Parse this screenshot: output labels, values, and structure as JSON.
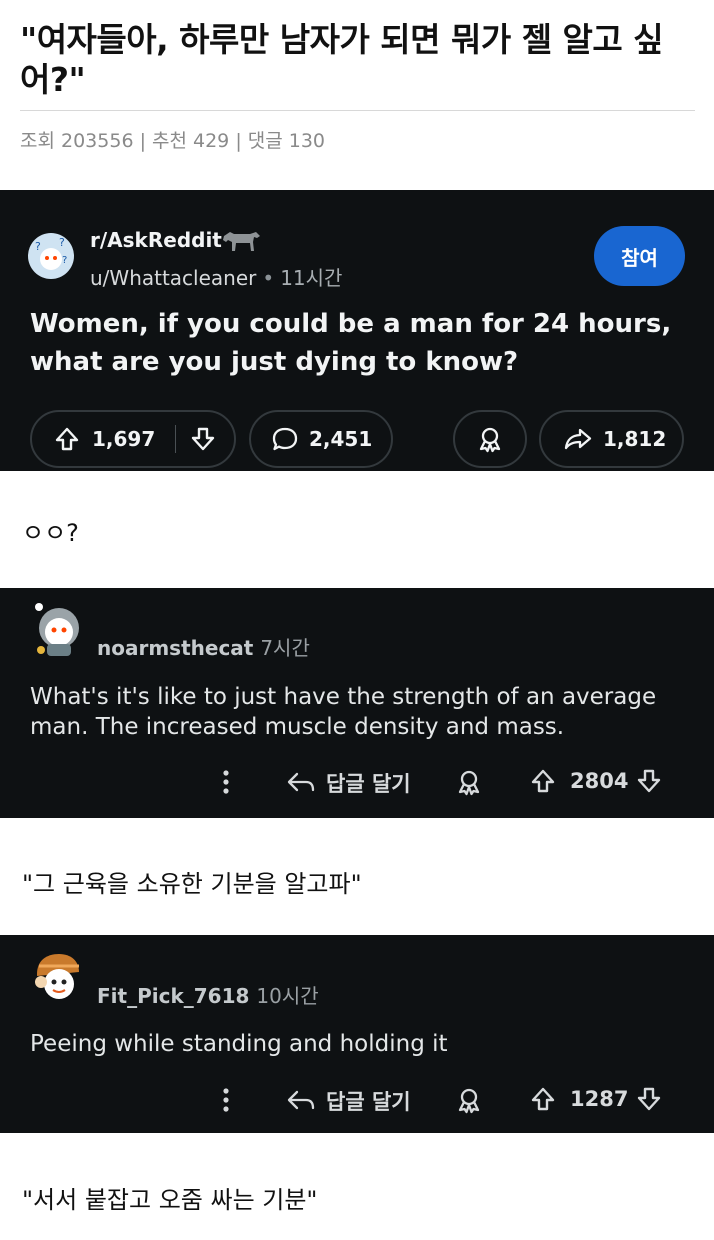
{
  "article": {
    "title": "\"여자들아, 하루만 남자가 되면 뭐가 젤 알고 싶어?\"",
    "meta": "조회 203556 | 추천 429 | 댓글 130"
  },
  "post": {
    "subreddit": "r/AskReddit",
    "author": "u/Whattacleaner",
    "separator": "•",
    "time": "11시간",
    "join_label": "참여",
    "title": "Women, if you could be a man for 24 hours, what are you just dying to know?",
    "upvotes": "1,697",
    "comments": "2,451",
    "shares": "1,812"
  },
  "captions": [
    "ㅇㅇ?",
    "\"그 근육을 소유한 기분을 알고파\"",
    "\"서서 붙잡고 오줌 싸는 기분\""
  ],
  "comments": [
    {
      "user": "noarmsthecat",
      "time": "7시간",
      "body": "What's it's like to just have the strength of an average man. The increased muscle density and mass.",
      "reply_label": "답글 달기",
      "votes": "2804"
    },
    {
      "user": "Fit_Pick_7618",
      "time": "10시간",
      "body": "Peeing while standing and holding it",
      "reply_label": "답글 달기",
      "votes": "1287"
    }
  ],
  "colors": {
    "dark_bg": "#0e1113",
    "join_blue": "#1966d1",
    "pill_border": "#33393d"
  },
  "icons": [
    "upvote-icon",
    "downvote-icon",
    "comment-icon",
    "award-icon",
    "share-icon",
    "more-icon",
    "reply-icon",
    "horse-icon"
  ]
}
